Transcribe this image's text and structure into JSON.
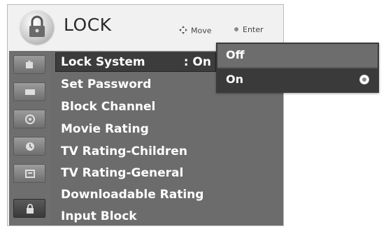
{
  "header": {
    "title": "LOCK",
    "hint_move": "Move",
    "hint_enter": "Enter"
  },
  "menu": {
    "items": [
      {
        "label": "Lock System",
        "value": ": On"
      },
      {
        "label": "Set Password"
      },
      {
        "label": "Block Channel"
      },
      {
        "label": "Movie Rating"
      },
      {
        "label": "TV Rating-Children"
      },
      {
        "label": "TV Rating-General"
      },
      {
        "label": "Downloadable Rating"
      },
      {
        "label": "Input Block"
      }
    ]
  },
  "popup": {
    "options": [
      "Off",
      "On"
    ],
    "selected": "On"
  },
  "sidebar": {
    "icons": [
      "picture-icon",
      "screen-icon",
      "audio-icon",
      "time-icon",
      "option-icon",
      "lock-icon"
    ]
  },
  "colors": {
    "selected_bg": "#3c3c3c",
    "menu_bg": "#6c6c6c",
    "accent_text": "#ffffff"
  }
}
